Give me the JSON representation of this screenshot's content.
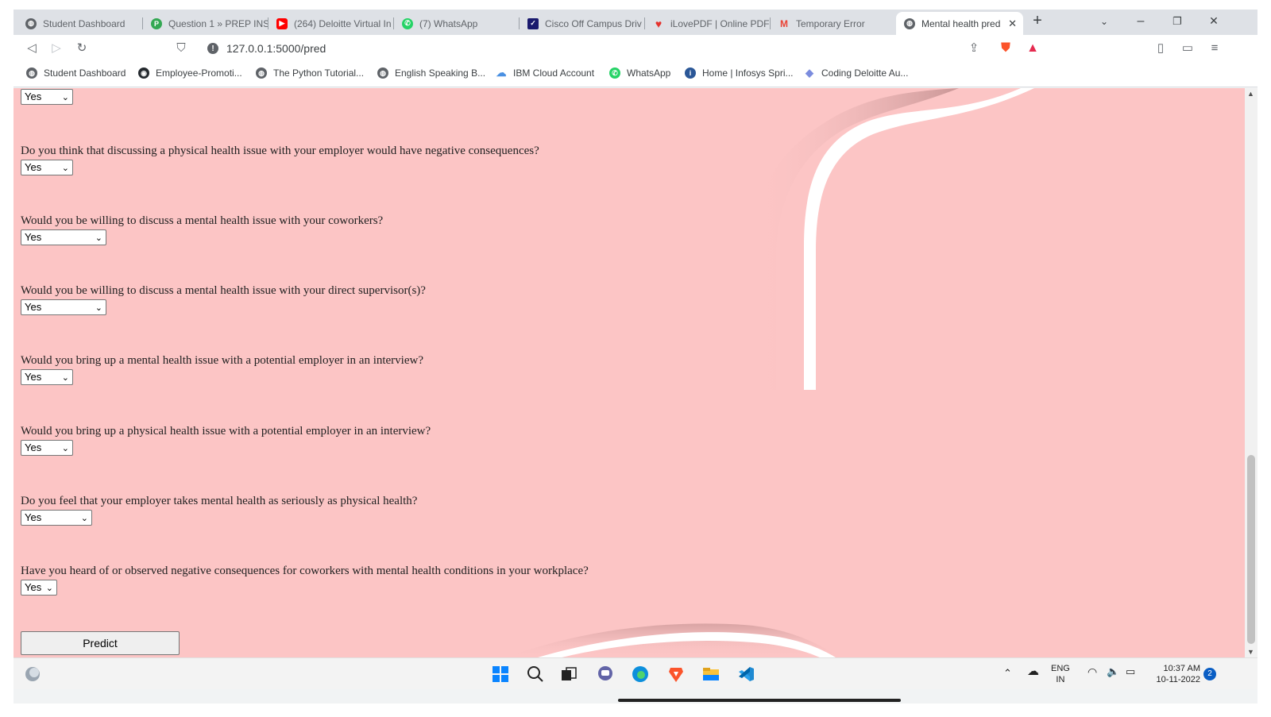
{
  "tabs": [
    {
      "title": "Student Dashboard",
      "icon": "globe-icon",
      "color": "#5f6368"
    },
    {
      "title": "Question 1 » PREP INS",
      "icon": "prepinsta-icon",
      "color": "#34a853"
    },
    {
      "title": "(264) Deloitte Virtual In",
      "icon": "youtube-icon",
      "color": "#ff0000"
    },
    {
      "title": "(7) WhatsApp",
      "icon": "whatsapp-icon",
      "color": "#25d366"
    },
    {
      "title": "Cisco Off Campus Driv",
      "icon": "checkmark-icon",
      "color": "#1a1a6e"
    },
    {
      "title": "iLovePDF | Online PDF",
      "icon": "heart-icon",
      "color": "#e5322d"
    },
    {
      "title": "Temporary Error",
      "icon": "gmail-icon",
      "color": "#ea4335"
    },
    {
      "title": "Mental health pred",
      "icon": "globe-icon",
      "color": "#5f6368",
      "active": true
    }
  ],
  "address": {
    "url": "127.0.0.1:5000/pred"
  },
  "bookmarks": [
    {
      "label": "Student Dashboard",
      "icon": "globe-icon",
      "color": "#5f6368"
    },
    {
      "label": "Employee-Promoti...",
      "icon": "github-icon",
      "color": "#24292e"
    },
    {
      "label": "The Python Tutorial...",
      "icon": "globe-icon",
      "color": "#5f6368"
    },
    {
      "label": "English Speaking B...",
      "icon": "globe-icon",
      "color": "#5f6368"
    },
    {
      "label": "IBM Cloud Account",
      "icon": "cloud-icon",
      "color": "#4a90e2"
    },
    {
      "label": "WhatsApp",
      "icon": "whatsapp-icon",
      "color": "#25d366"
    },
    {
      "label": "Home | Infosys Spri...",
      "icon": "infosys-icon",
      "color": "#2b5797"
    },
    {
      "label": "Coding Deloitte Au...",
      "icon": "diamond-icon",
      "color": "#7b8cde"
    }
  ],
  "form": {
    "top_select": {
      "value": "Yes"
    },
    "questions": [
      {
        "label": "Do you think that discussing a physical health issue with your employer would have negative consequences?",
        "value": "Yes"
      },
      {
        "label": "Would you be willing to discuss a mental health issue with your coworkers?",
        "value": "Yes"
      },
      {
        "label": "Would you be willing to discuss a mental health issue with your direct supervisor(s)?",
        "value": "Yes"
      },
      {
        "label": "Would you bring up a mental health issue with a potential employer in an interview?",
        "value": "Yes"
      },
      {
        "label": "Would you bring up a physical health issue with a potential employer in an interview?",
        "value": "Yes"
      },
      {
        "label": "Do you feel that your employer takes mental health as seriously as physical health?",
        "value": "Yes"
      },
      {
        "label": "Have you heard of or observed negative consequences for coworkers with mental health conditions in your workplace?",
        "value": "Yes"
      }
    ],
    "submit_label": "Predict"
  },
  "page_colors": {
    "background": "#fcc5c5",
    "swoosh": "#ffffff"
  },
  "taskbar": {
    "apps": [
      "windows-start-icon",
      "search-icon",
      "task-view-icon",
      "teams-chat-icon",
      "edge-icon",
      "brave-icon",
      "file-explorer-icon",
      "vscode-icon"
    ],
    "language": {
      "line1": "ENG",
      "line2": "IN"
    },
    "time": "10:37 AM",
    "date": "10-11-2022",
    "notifications": "2"
  }
}
